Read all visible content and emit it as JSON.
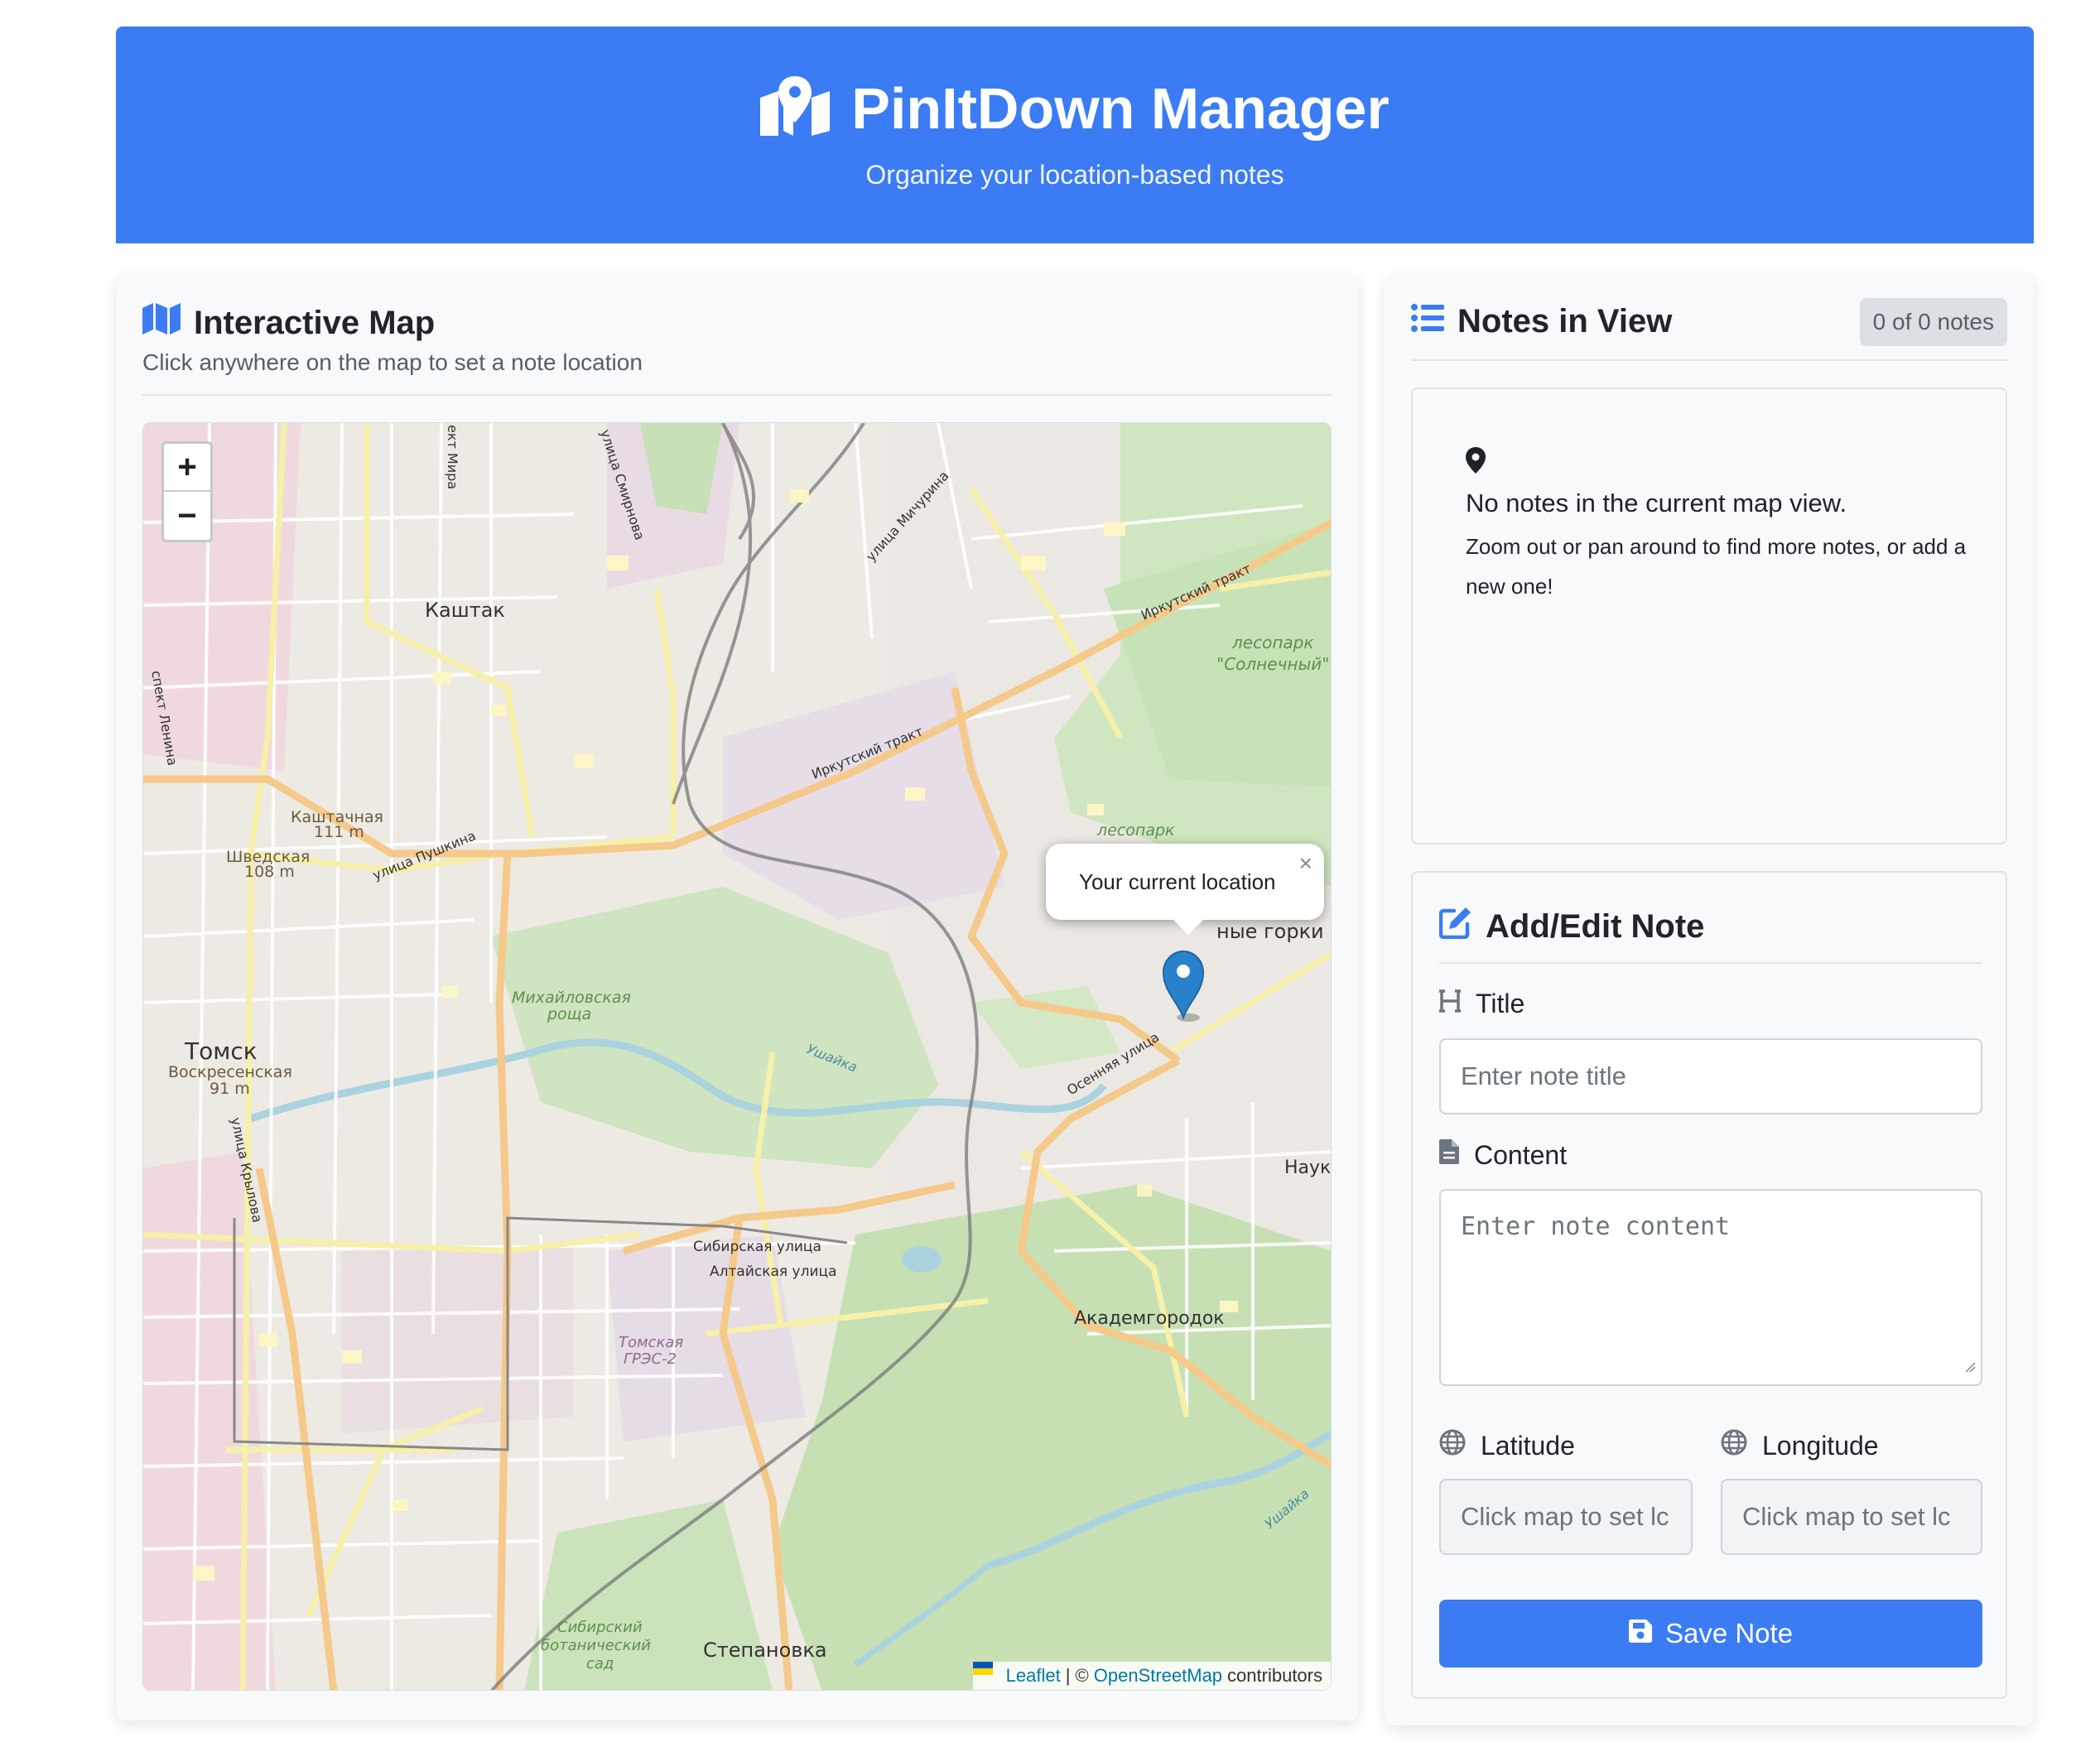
{
  "header": {
    "title": "PinItDown Manager",
    "subtitle": "Organize your location-based notes"
  },
  "map_panel": {
    "title": "Interactive Map",
    "subtitle": "Click anywhere on the map to set a note location",
    "zoom_in": "+",
    "zoom_out": "−",
    "popup_text": "Your current location",
    "popup_close": "×",
    "attribution": {
      "leaflet": "Leaflet",
      "separator": "| ©",
      "osm": "OpenStreetMap",
      "suffix": "contributors"
    },
    "map_labels": {
      "kashtak": "Каштак",
      "tomsk": "Томск",
      "voskresenskaya": "Воскресенская",
      "voskresenskaya_height": "91 m",
      "kashtachnaya": "Каштачная",
      "kashtachnaya_height": "111 m",
      "shvedskaya": "Шведская",
      "shvedskaya_height": "108 m",
      "mikhaylovskaya": "Михайловская",
      "roshcha": "роща",
      "lesopark": "лесопарк",
      "solnechny": "\"Солнечный\"",
      "lesopark2": "лесопарк",
      "gorki": "ные горки",
      "akademgorodok": "Академгородок",
      "stepanovka": "Степановка",
      "nauka": "Наук",
      "irkutsky_trakt_1": "Иркутский тракт",
      "irkutsky_trakt_2": "Иркутский тракт",
      "ushayka": "Ушайка",
      "ushayka2": "Ушайка",
      "sibirskaya": "Сибирская улица",
      "altayskaya": "Алтайская улица",
      "osennyaya": "Осенняя улица",
      "pushkina": "улица Пушкина",
      "michurina": "улица Мичурина",
      "smirnova": "улица Смирнова",
      "mira": "ект Мира",
      "lenina": "спект Ленина",
      "krylova": "улица Крылова",
      "grees": "Томская",
      "grees2": "ГРЭС-2",
      "botanic1": "Сибирский",
      "botanic2": "ботанический",
      "botanic3": "сад"
    }
  },
  "notes_panel": {
    "title": "Notes in View",
    "count_badge": "0 of 0 notes",
    "empty_title": "No notes in the current map view.",
    "empty_subtitle": "Zoom out or pan around to find more notes, or add a new one!"
  },
  "form": {
    "title": "Add/Edit Note",
    "title_label": "Title",
    "title_placeholder": "Enter note title",
    "content_label": "Content",
    "content_placeholder": "Enter note content",
    "latitude_label": "Latitude",
    "latitude_placeholder": "Click map to set lc",
    "longitude_label": "Longitude",
    "longitude_placeholder": "Click map to set lc",
    "save_label": "Save Note"
  },
  "colors": {
    "primary": "#3b7cf4",
    "map_background": "#ece8e2",
    "marker": "#2a81cb"
  },
  "icons": [
    "map-location-icon",
    "folded-map-icon",
    "list-icon",
    "location-pin-icon",
    "edit-icon",
    "heading-icon",
    "file-icon",
    "globe-icon",
    "save-icon"
  ]
}
